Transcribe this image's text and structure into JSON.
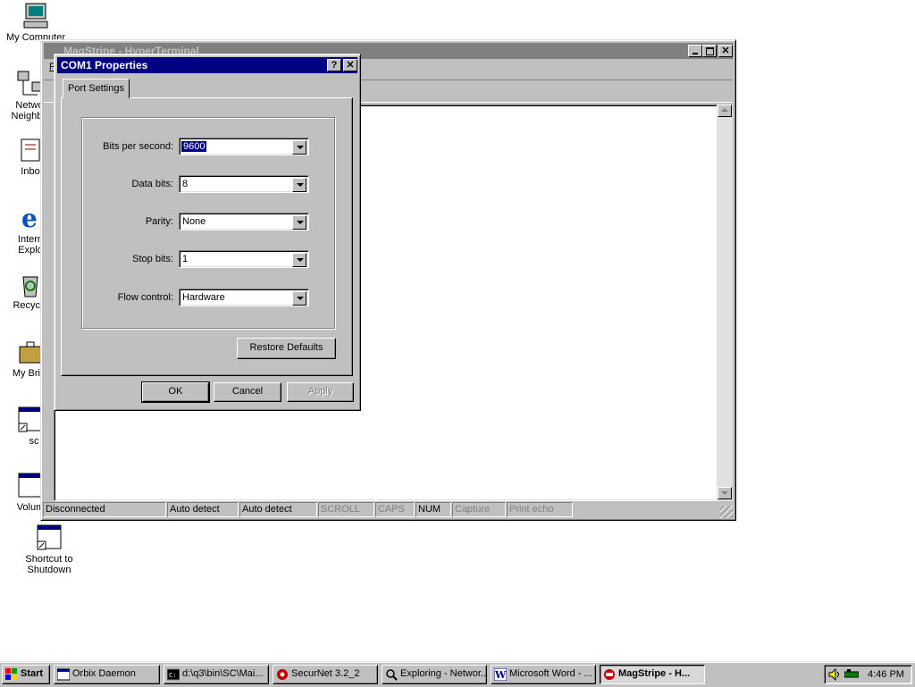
{
  "desktop": {
    "icons": [
      {
        "label": "My Computer"
      },
      {
        "label": "Netwo Neighbo"
      },
      {
        "label": "Inbo"
      },
      {
        "label": "Intern Explo"
      },
      {
        "label": "Recycle"
      },
      {
        "label": "My Brief"
      },
      {
        "label": "sc"
      },
      {
        "label": "Volum"
      },
      {
        "label": "Shortcut to Shutdown"
      }
    ]
  },
  "hyperterminal": {
    "title": "MagStripe - HyperTerminal",
    "menu_first": "F",
    "status": [
      "Disconnected",
      "Auto detect",
      "Auto detect",
      "SCROLL",
      "CAPS",
      "NUM",
      "Capture",
      "Print echo"
    ]
  },
  "dialog": {
    "title": "COM1 Properties",
    "help_btn": "?",
    "close_btn": "✕",
    "tab": "Port Settings",
    "fields": [
      {
        "label": "Bits per second:",
        "value": "9600"
      },
      {
        "label": "Data bits:",
        "value": "8"
      },
      {
        "label": "Parity:",
        "value": "None"
      },
      {
        "label": "Stop bits:",
        "value": "1"
      },
      {
        "label": "Flow control:",
        "value": "Hardware"
      }
    ],
    "restore": "Restore Defaults",
    "ok": "OK",
    "cancel": "Cancel",
    "apply": "Apply"
  },
  "taskbar": {
    "start": "Start",
    "items": [
      {
        "label": "Orbix Daemon"
      },
      {
        "label": "d:\\q3\\bin\\SC\\Mai..."
      },
      {
        "label": "SecurNet 3.2_2"
      },
      {
        "label": "Exploring - Networ..."
      },
      {
        "label": "Microsoft Word - ..."
      },
      {
        "label": "MagStripe - H..."
      }
    ],
    "clock": "4:46 PM"
  }
}
